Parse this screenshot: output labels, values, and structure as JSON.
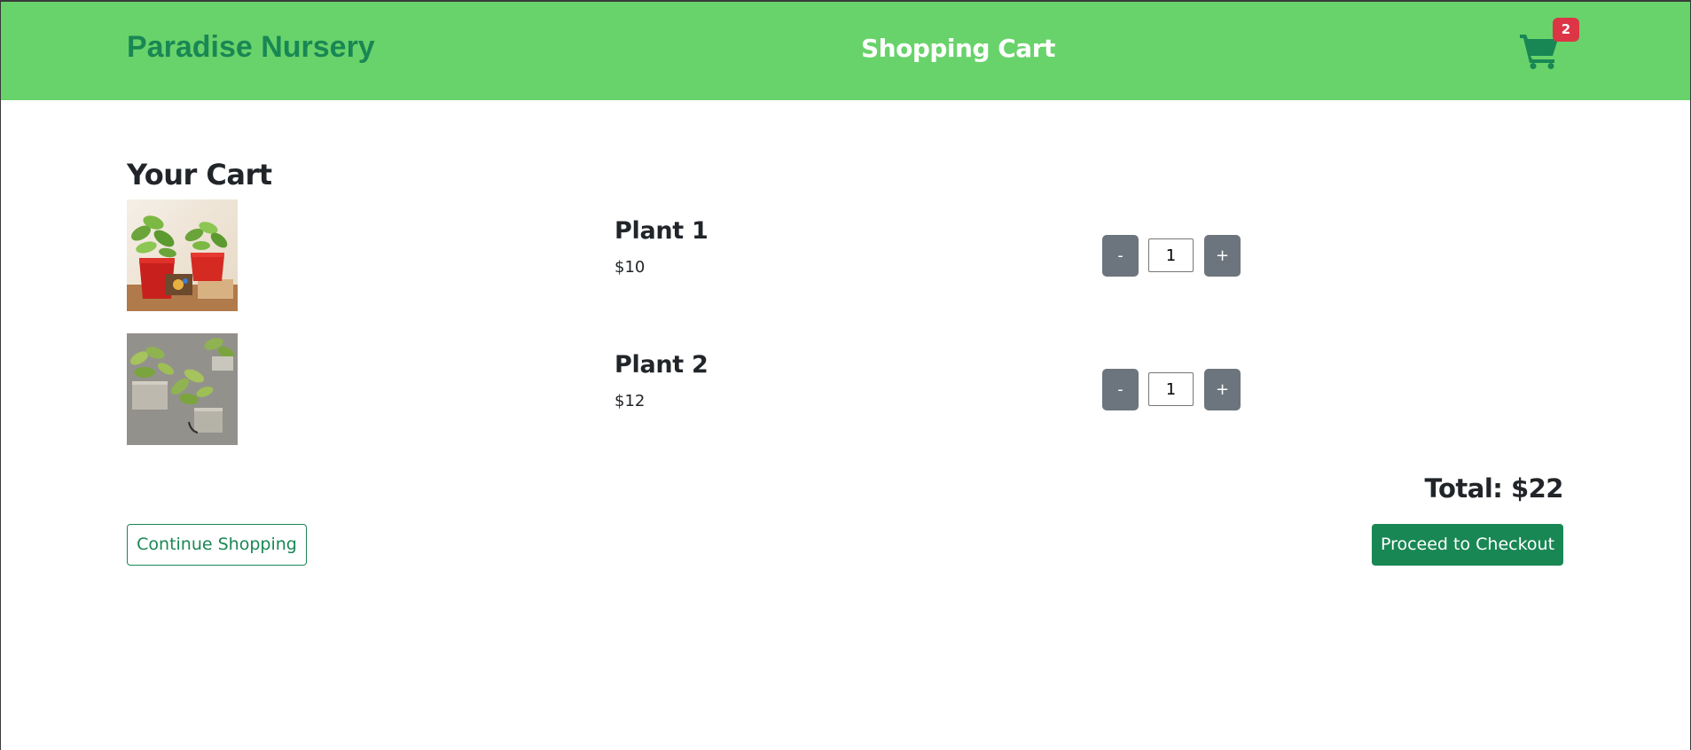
{
  "header": {
    "brand": "Paradise Nursery",
    "title": "Shopping Cart",
    "cart_count": "2"
  },
  "cart": {
    "heading": "Your Cart",
    "items": [
      {
        "name": "Plant 1",
        "price": "$10",
        "quantity": "1",
        "image": "two-potted-plants-red-pots-photo"
      },
      {
        "name": "Plant 2",
        "price": "$12",
        "quantity": "1",
        "image": "wall-hanging-potted-plants-photo"
      }
    ],
    "decrement_label": "-",
    "increment_label": "+",
    "total": "Total: $22"
  },
  "actions": {
    "continue_label": "Continue Shopping",
    "checkout_label": "Proceed to Checkout"
  },
  "colors": {
    "navbar": "#68d36a",
    "brand": "#198754",
    "badge": "#dc3545",
    "qty_button": "#6c757d",
    "checkout": "#198754"
  },
  "icons": {
    "cart": "shopping-cart-icon"
  }
}
